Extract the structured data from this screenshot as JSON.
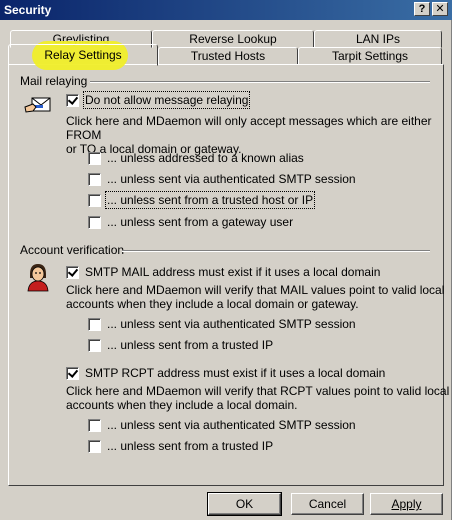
{
  "window": {
    "title": "Security",
    "help_label": "?",
    "close_label": "✕"
  },
  "tabs": {
    "row1": [
      "Greylisting",
      "Reverse Lookup",
      "LAN IPs"
    ],
    "row2": [
      "Relay Settings",
      "Trusted Hosts",
      "Tarpit Settings"
    ],
    "active": "Relay Settings"
  },
  "mail_relaying": {
    "group_label": "Mail relaying",
    "icon": "envelope-hand-icon",
    "main_checkbox": {
      "label": "Do not allow message relaying",
      "checked": true
    },
    "description": "Click here and MDaemon will only accept messages which are either FROM or TO a local domain or gateway.",
    "description_line1": "Click here and MDaemon will only accept messages which are either FROM",
    "description_line2": "or TO a local domain or gateway.",
    "options": [
      {
        "label": "... unless addressed to a known alias",
        "checked": false
      },
      {
        "label": "... unless sent via authenticated SMTP session",
        "checked": false
      },
      {
        "label": "... unless sent from a trusted host or IP",
        "checked": false
      },
      {
        "label": "... unless sent from a gateway user",
        "checked": false
      }
    ]
  },
  "account_verification": {
    "group_label": "Account verification",
    "icon": "user-icon",
    "mail_checkbox": {
      "label": "SMTP MAIL address must exist if it uses a local domain",
      "checked": true
    },
    "mail_desc_line1": "Click here and MDaemon will verify that MAIL values point to valid local",
    "mail_desc_line2": "accounts when they include a local domain or gateway.",
    "mail_options": [
      {
        "label": "... unless sent via authenticated SMTP session",
        "checked": false
      },
      {
        "label": "... unless sent from a trusted IP",
        "checked": false
      }
    ],
    "rcpt_checkbox": {
      "label": "SMTP RCPT address must exist if it uses a local domain",
      "checked": true
    },
    "rcpt_desc_line1": "Click here and MDaemon will verify that RCPT values point to valid local",
    "rcpt_desc_line2": "accounts when they include a local domain.",
    "rcpt_options": [
      {
        "label": "... unless sent via authenticated SMTP session",
        "checked": false
      },
      {
        "label": "... unless sent from a trusted IP",
        "checked": false
      }
    ]
  },
  "buttons": {
    "ok": "OK",
    "cancel": "Cancel",
    "apply": "Apply"
  },
  "colors": {
    "titlebar_start": "#0a246a",
    "titlebar_end": "#3a6ea5",
    "highlight": "#f0ee2a",
    "face": "#d4d0c8"
  }
}
